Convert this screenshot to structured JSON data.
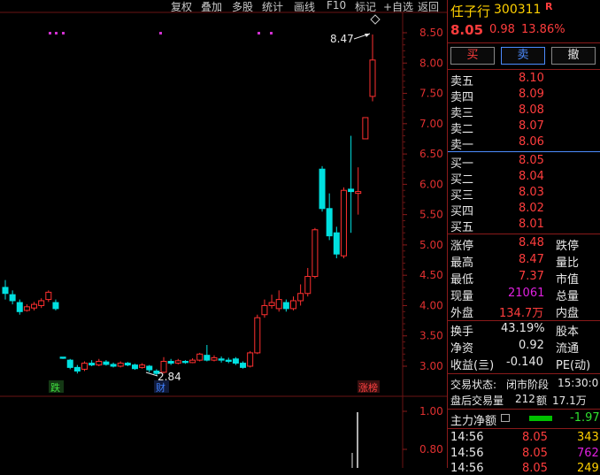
{
  "toolbar": {
    "items": [
      "复权",
      "叠加",
      "多股",
      "统计",
      "画线",
      "F10",
      "标记",
      "+自选",
      "返回"
    ]
  },
  "stock": {
    "name": "任子行",
    "code": "300311",
    "flag": "R",
    "price": "8.05",
    "change": "0.98",
    "pct": "13.86%"
  },
  "buttons": {
    "buy": "买",
    "sell": "卖",
    "cancel": "撤"
  },
  "asks": [
    {
      "label": "卖五",
      "price": "8.10"
    },
    {
      "label": "卖四",
      "price": "8.09"
    },
    {
      "label": "卖三",
      "price": "8.08"
    },
    {
      "label": "卖二",
      "price": "8.07"
    },
    {
      "label": "卖一",
      "price": "8.06"
    }
  ],
  "bids": [
    {
      "label": "买一",
      "price": "8.05"
    },
    {
      "label": "买二",
      "price": "8.04"
    },
    {
      "label": "买三",
      "price": "8.03"
    },
    {
      "label": "买四",
      "price": "8.02"
    },
    {
      "label": "买五",
      "price": "8.01"
    }
  ],
  "stats": {
    "r1": {
      "l1": "涨停",
      "v1": "8.48",
      "l2": "跌停"
    },
    "r2": {
      "l1": "最高",
      "v1": "8.47",
      "l2": "量比"
    },
    "r3": {
      "l1": "最低",
      "v1": "7.37",
      "l2": "市值"
    },
    "r4": {
      "l1": "现量",
      "v1": "21061",
      "l2": "总量"
    },
    "r5": {
      "l1": "外盘",
      "v1": "134.7万",
      "l2": "内盘"
    }
  },
  "fund": {
    "r1": {
      "l1": "换手",
      "v1": "43.19%",
      "l2": "股本"
    },
    "r2": {
      "l1": "净资",
      "v1": "0.92",
      "l2": "流通"
    },
    "r3": {
      "l1": "收益(亖)",
      "v1": "-0.140",
      "l2": "PE(动)"
    }
  },
  "trade_state": {
    "label": "交易状态:",
    "state": "闭市阶段",
    "time": "15:30:0"
  },
  "after_hours": {
    "label": "盘后交易量",
    "vol": "212",
    "amount_label": "额",
    "amount": "17.1万"
  },
  "main_flow": {
    "label": "主力净额",
    "value": "-1.97"
  },
  "ticks": [
    {
      "time": "14:56",
      "price": "8.05",
      "vol": "343"
    },
    {
      "time": "14:56",
      "price": "8.05",
      "vol": "762"
    },
    {
      "time": "14:56",
      "price": "8.05",
      "vol": "249"
    }
  ],
  "chart_data": {
    "type": "candlestick",
    "y_ticks": [
      "8.50",
      "8.00",
      "7.50",
      "7.00",
      "6.50",
      "6.00",
      "5.50",
      "5.00",
      "4.50",
      "4.00",
      "3.50",
      "3.00"
    ],
    "vol_ticks": [
      "1.00",
      "0.80"
    ],
    "annotations": {
      "high": "8.47",
      "low": "2.84",
      "tag1": "跌",
      "tag2": "财",
      "tag3": "涨榜"
    },
    "candles": [
      {
        "o": 4.3,
        "c": 4.2,
        "h": 4.42,
        "l": 4.1
      },
      {
        "o": 4.18,
        "c": 4.08,
        "h": 4.25,
        "l": 4.02
      },
      {
        "o": 4.05,
        "c": 3.9,
        "h": 4.1,
        "l": 3.85
      },
      {
        "o": 3.92,
        "c": 3.98,
        "h": 4.02,
        "l": 3.9
      },
      {
        "o": 3.96,
        "c": 4.02,
        "h": 4.06,
        "l": 3.92
      },
      {
        "o": 4.0,
        "c": 4.08,
        "h": 4.12,
        "l": 3.96
      },
      {
        "o": 4.1,
        "c": 4.22,
        "h": 4.25,
        "l": 4.06
      },
      {
        "o": 4.05,
        "c": 3.95,
        "h": 4.1,
        "l": 3.92
      },
      {
        "o": 3.15,
        "c": 3.13,
        "h": 3.15,
        "l": 3.12
      },
      {
        "o": 3.1,
        "c": 2.98,
        "h": 3.12,
        "l": 2.95
      },
      {
        "o": 2.98,
        "c": 2.92,
        "h": 3.02,
        "l": 2.88
      },
      {
        "o": 2.95,
        "c": 3.05,
        "h": 3.08,
        "l": 2.92
      },
      {
        "o": 3.05,
        "c": 3.02,
        "h": 3.1,
        "l": 3.0
      },
      {
        "o": 3.02,
        "c": 3.08,
        "h": 3.12,
        "l": 3.0
      },
      {
        "o": 3.07,
        "c": 3.03,
        "h": 3.1,
        "l": 3.01
      },
      {
        "o": 3.03,
        "c": 3.0,
        "h": 3.06,
        "l": 2.98
      },
      {
        "o": 3.0,
        "c": 3.05,
        "h": 3.08,
        "l": 2.98
      },
      {
        "o": 3.05,
        "c": 3.02,
        "h": 3.07,
        "l": 3.0
      },
      {
        "o": 3.02,
        "c": 2.96,
        "h": 3.04,
        "l": 2.94
      },
      {
        "o": 2.98,
        "c": 3.02,
        "h": 3.05,
        "l": 2.96
      },
      {
        "o": 3.0,
        "c": 2.94,
        "h": 3.02,
        "l": 2.9
      },
      {
        "o": 2.92,
        "c": 2.88,
        "h": 2.95,
        "l": 2.84
      },
      {
        "o": 2.9,
        "c": 3.08,
        "h": 3.15,
        "l": 2.88
      },
      {
        "o": 3.08,
        "c": 3.05,
        "h": 3.12,
        "l": 3.02
      },
      {
        "o": 3.05,
        "c": 3.09,
        "h": 3.12,
        "l": 3.03
      },
      {
        "o": 3.08,
        "c": 3.06,
        "h": 3.1,
        "l": 3.04
      },
      {
        "o": 3.06,
        "c": 3.1,
        "h": 3.13,
        "l": 3.05
      },
      {
        "o": 3.1,
        "c": 3.2,
        "h": 3.22,
        "l": 3.08
      },
      {
        "o": 3.18,
        "c": 3.1,
        "h": 3.35,
        "l": 3.08
      },
      {
        "o": 3.1,
        "c": 3.14,
        "h": 3.18,
        "l": 3.08
      },
      {
        "o": 3.12,
        "c": 3.1,
        "h": 3.16,
        "l": 3.06
      },
      {
        "o": 3.1,
        "c": 3.08,
        "h": 3.14,
        "l": 3.05
      },
      {
        "o": 3.12,
        "c": 3.05,
        "h": 3.15,
        "l": 3.02
      },
      {
        "o": 3.05,
        "c": 2.98,
        "h": 3.08,
        "l": 2.96
      },
      {
        "o": 3.0,
        "c": 3.22,
        "h": 3.25,
        "l": 2.98
      },
      {
        "o": 3.22,
        "c": 3.8,
        "h": 3.85,
        "l": 3.2
      },
      {
        "o": 3.85,
        "c": 4.0,
        "h": 4.1,
        "l": 3.8
      },
      {
        "o": 4.0,
        "c": 4.05,
        "h": 4.18,
        "l": 3.95
      },
      {
        "o": 3.95,
        "c": 4.1,
        "h": 4.25,
        "l": 3.9
      },
      {
        "o": 4.05,
        "c": 3.95,
        "h": 4.1,
        "l": 3.9
      },
      {
        "o": 3.95,
        "c": 4.08,
        "h": 4.15,
        "l": 3.92
      },
      {
        "o": 4.08,
        "c": 4.2,
        "h": 4.35,
        "l": 4.0
      },
      {
        "o": 4.2,
        "c": 4.48,
        "h": 4.62,
        "l": 4.15
      },
      {
        "o": 4.48,
        "c": 5.25,
        "h": 5.28,
        "l": 4.45
      },
      {
        "o": 6.25,
        "c": 5.6,
        "h": 6.3,
        "l": 5.55
      },
      {
        "o": 5.6,
        "c": 5.15,
        "h": 5.85,
        "l": 5.08
      },
      {
        "o": 5.2,
        "c": 4.85,
        "h": 5.3,
        "l": 4.78
      },
      {
        "o": 4.82,
        "c": 5.9,
        "h": 5.95,
        "l": 4.78
      },
      {
        "o": 5.92,
        "c": 5.88,
        "h": 6.8,
        "l": 5.2
      },
      {
        "o": 5.85,
        "c": 5.88,
        "h": 6.28,
        "l": 5.5
      },
      {
        "o": 6.75,
        "c": 7.1,
        "h": 7.1,
        "l": 6.75
      },
      {
        "o": 7.45,
        "c": 8.05,
        "h": 8.47,
        "l": 7.37
      }
    ]
  }
}
